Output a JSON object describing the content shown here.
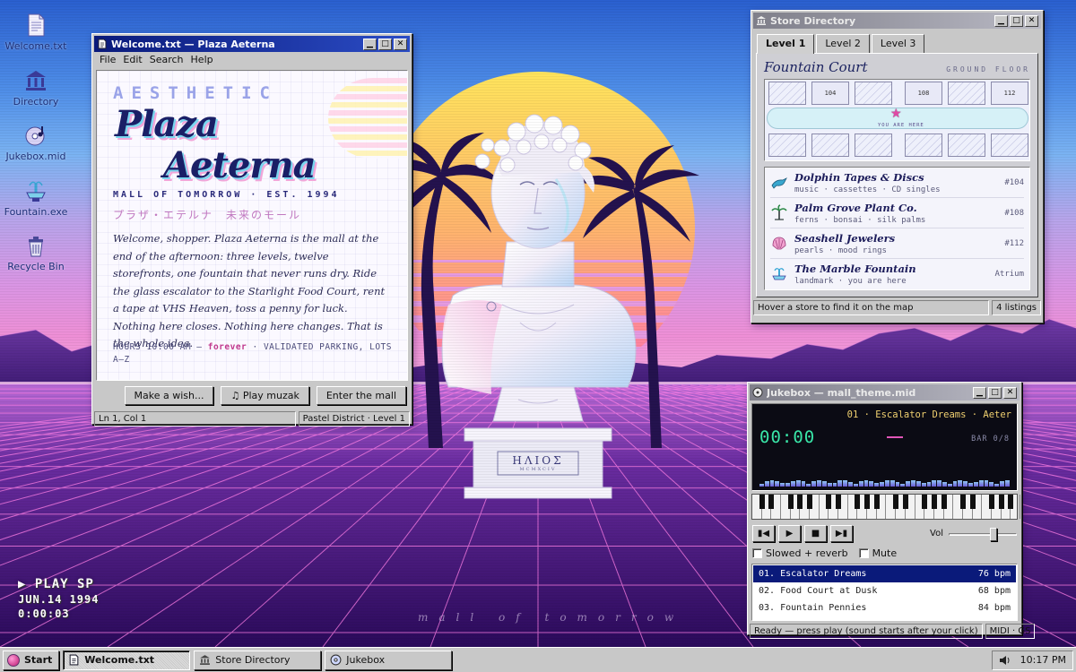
{
  "desktop": {
    "icons": [
      {
        "label": "Welcome.txt",
        "icon": "text-file-icon"
      },
      {
        "label": "Directory",
        "icon": "bank-building-icon"
      },
      {
        "label": "Jukebox.mid",
        "icon": "cd-music-icon"
      },
      {
        "label": "Fountain.exe",
        "icon": "fountain-icon"
      },
      {
        "label": "Recycle Bin",
        "icon": "recycle-bin-icon"
      }
    ],
    "bust_inscription": "ΗΛΙΟΣ",
    "bust_numeral": "MCMXCIV",
    "tagline": "mall of tomorrow",
    "vhs": {
      "mode": "▶ PLAY  SP",
      "date": "JUN.14 1994",
      "counter": "0:00:03"
    }
  },
  "welcome": {
    "title": "Welcome.txt — Plaza Aeterna",
    "menu": [
      "File",
      "Edit",
      "Search",
      "Help"
    ],
    "eyebrow": "AESTHETIC",
    "title_line1": "Plaza",
    "title_line2": "Aeterna",
    "mall_line": "MALL OF TOMORROW · EST. 1994",
    "jp_line": "プラザ・エテルナ　未来のモール",
    "body": "Welcome, shopper. Plaza Aeterna is the mall at the end of the afternoon: three levels, twelve storefronts, one fountain that never runs dry. Ride the glass escalator to the Starlight Food Court, rent a tape at VHS Heaven, toss a penny for luck. Nothing here closes. Nothing here changes. That is the whole idea.",
    "hours_prefix": "HOURS  10:00 AM — ",
    "hours_accent": "forever",
    "hours_suffix": "  ·  VALIDATED PARKING, LOTS A–Z",
    "buttons": {
      "wish": "Make a wish...",
      "muzak": "♫ Play muzak",
      "enter": "Enter the mall"
    },
    "status": {
      "position": "Ln 1, Col 1",
      "location": "Pastel District · Level 1"
    }
  },
  "directory": {
    "title": "Store Directory",
    "tabs": [
      "Level 1",
      "Level 2",
      "Level 3"
    ],
    "active_tab": "Level 1",
    "court": "Fountain Court",
    "floor": "GROUND FLOOR",
    "map_labels": {
      "s104": "104",
      "s108": "108",
      "s112": "112",
      "here": "YOU ARE HERE"
    },
    "stores": [
      {
        "name": "Dolphin Tapes & Discs",
        "tags": "music · cassettes · CD singles",
        "code": "#104",
        "icon": "dolphin-icon"
      },
      {
        "name": "Palm Grove Plant Co.",
        "tags": "ferns · bonsai · silk palms",
        "code": "#108",
        "icon": "palm-tree-icon"
      },
      {
        "name": "Seashell Jewelers",
        "tags": "pearls · mood rings",
        "code": "#112",
        "icon": "seashell-icon"
      },
      {
        "name": "The Marble Fountain",
        "tags": "landmark · you are here",
        "code": "Atrium",
        "icon": "fountain-icon"
      }
    ],
    "status": {
      "hint": "Hover a store to find it on the map",
      "count": "4 listings"
    }
  },
  "jukebox": {
    "title": "Jukebox — mall_theme.mid",
    "marquee": "01 · Escalator Dreams · Aeter",
    "clock": "00:00",
    "bar": "BAR 0/8",
    "volume_label": "Vol",
    "volume_level": 0.68,
    "options": {
      "slowed": "Slowed + reverb",
      "mute": "Mute"
    },
    "tracks": [
      {
        "name": "01. Escalator Dreams",
        "bpm": "76 bpm"
      },
      {
        "name": "02. Food Court at Dusk",
        "bpm": "68 bpm"
      },
      {
        "name": "03. Fountain Pennies",
        "bpm": "84 bpm"
      }
    ],
    "status": {
      "message": "Ready — press play (sound starts after your click)",
      "format": "MIDI · GS"
    }
  },
  "taskbar": {
    "start": "Start",
    "tasks": [
      "Welcome.txt",
      "Store Directory",
      "Jukebox"
    ],
    "clock": "10:17 PM"
  }
}
